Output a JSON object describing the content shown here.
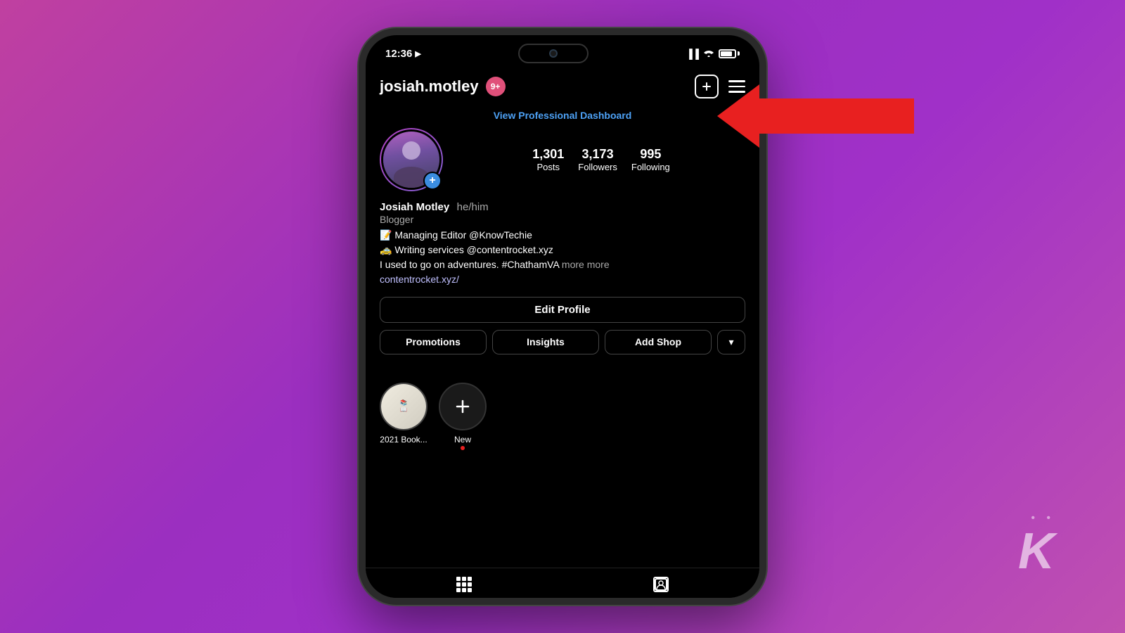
{
  "background": {
    "gradient": "linear-gradient(135deg, #c040a0 0%, #9b2fc0 40%, #a030c8 60%, #c050b0 100%)"
  },
  "status_bar": {
    "time": "12:36",
    "location_icon": "▶",
    "signal_bars": "▐▐",
    "wifi_icon": "wifi",
    "battery_level": "85"
  },
  "header": {
    "username": "josiah.motley",
    "notification_count": "9+",
    "add_icon": "+",
    "menu_icon": "≡"
  },
  "pro_dashboard": {
    "link_text": "View Professional Dashboard"
  },
  "profile": {
    "display_name": "Josiah Motley",
    "pronouns": "he/him",
    "category": "Blogger",
    "bio_line1": "📝 Managing Editor @KnowTechie",
    "bio_line2": "🚕 Writing services @contentrocket.xyz",
    "bio_line3": "I used to go on adventures. #ChathamVA",
    "bio_more": "more",
    "bio_link": "contentrocket.xyz/",
    "stats": {
      "posts": {
        "count": "1,301",
        "label": "Posts"
      },
      "followers": {
        "count": "3,173",
        "label": "Followers"
      },
      "following": {
        "count": "995",
        "label": "Following"
      }
    }
  },
  "buttons": {
    "edit_profile": "Edit Profile",
    "promotions": "Promotions",
    "insights": "Insights",
    "add_shop": "Add Shop",
    "dropdown": "▾"
  },
  "highlights": [
    {
      "label": "2021 Book...",
      "type": "image"
    },
    {
      "label": "New",
      "type": "new"
    }
  ],
  "bottom_nav": {
    "grid_icon": "grid",
    "tag_icon": "person-tag"
  },
  "arrow": {
    "visible": true
  },
  "kt_logo": {
    "dots": "• •",
    "letter": "K"
  }
}
